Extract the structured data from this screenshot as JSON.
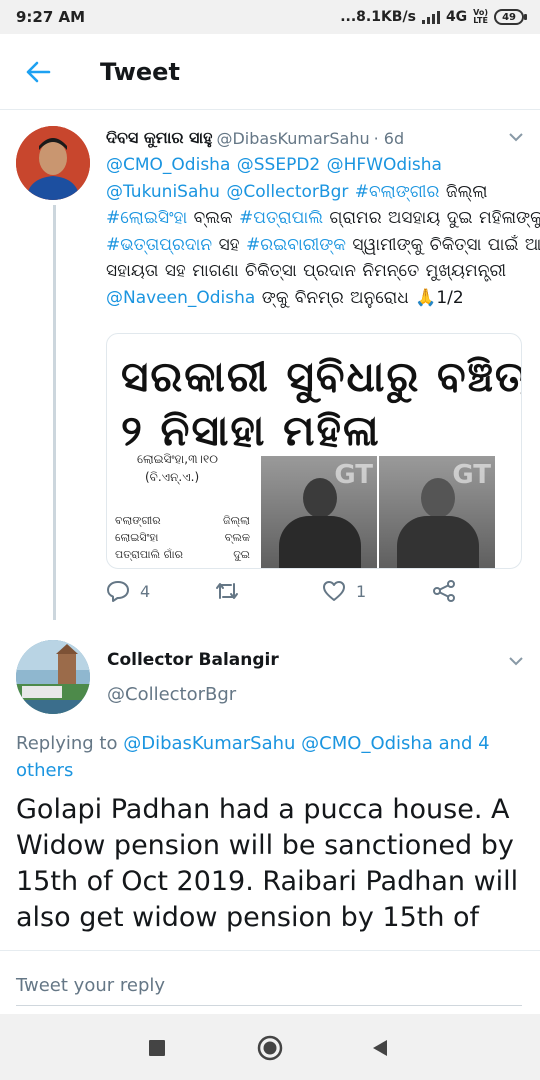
{
  "status_bar": {
    "time": "9:27 AM",
    "speed": "...8.1KB/s",
    "network": "4G",
    "volte": "Vo)) LTE",
    "battery": "49"
  },
  "header": {
    "title": "Tweet",
    "back_icon": "arrow-left-icon"
  },
  "tweet1": {
    "name": "ଦିବସ କୁମାର ସାହୁ",
    "handle": "@DibasKumarSahu",
    "time": "· 6d",
    "body_lines": [
      [
        "link",
        "@CMO_Odisha @SSEPD2 @HFWOdisha"
      ],
      [
        "link",
        "@TukuniSahu @CollectorBgr #ବଲାଙ୍ଗୀର ",
        "text",
        "ଜିଲ୍ଲା"
      ],
      [
        "link",
        "#ଲୋଇସିଂହା ",
        "text",
        "ବ୍ଲକ ",
        "link",
        "#ପତ୍ରାପାଲି ",
        "text",
        "ଗ୍ରାମର ଅସହାୟ ଦୁଇ ମହିଳାଙ୍କୁ"
      ],
      [
        "link",
        "#ଭତ୍ତାପ୍ରଦାନ ",
        "text",
        "ସହ ",
        "link",
        "#ରଇବାରୀଙ୍କ ",
        "text",
        "ସ୍ୱାମୀଙ୍କୁ ଚିକିତ୍ସା ପାଇଁ ଆର୍ଥିକ"
      ],
      [
        "text",
        "ସହାୟତା ସହ ମାଗଣା ଚିକିତ୍ସା ପ୍ରଦାନ ନିମନ୍ତେ ମୁଖ୍ୟମନ୍ତ୍ରୀ"
      ],
      [
        "link",
        "@Naveen_Odisha ",
        "text",
        "ଙ୍କୁ ବିନମ୍ର ଅନୁରୋଧ 🙏1/2"
      ]
    ],
    "media": {
      "headline1": "ସରକାରୀ ସୁବିଧାରୁ ବଞ୍ଚିତ୍",
      "headline2": "୨ ନିସାହା ମହିଳା",
      "dateline1": "ଲୋଇସିଂହା,୩।୧୦",
      "dateline2": "(ବି.ଏନ୍.ଏ.)",
      "col_left": [
        "ବଲାଙ୍ଗୀର",
        "ଲୋଇସିଂହା",
        "ପତ୍ରାପାଲି   ଗାଁର"
      ],
      "col_right": [
        "ଜିଲ୍ଲା",
        "ବ୍ଲକ",
        "ଦୁଇ"
      ],
      "watermark1": "GT",
      "watermark2": "GT"
    },
    "actions": {
      "reply_count": "4",
      "retweet_count": "",
      "like_count": "1"
    }
  },
  "tweet2": {
    "name": "Collector Balangir",
    "handle": "@CollectorBgr",
    "replying_prefix": "Replying to ",
    "replying_to": "@DibasKumarSahu @CMO_Odisha and 4 others",
    "text": "Golapi Padhan had a pucca house. A Widow pension will be sanctioned by 15th of Oct 2019. Raibari Padhan will also get widow pension by 15th of"
  },
  "reply_bar": {
    "placeholder": "Tweet your reply"
  },
  "colors": {
    "link": "#1b95e0",
    "muted": "#657786",
    "text": "#14171a"
  }
}
